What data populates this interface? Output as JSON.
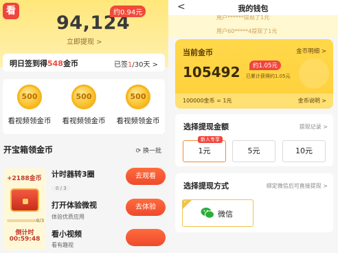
{
  "left": {
    "logo_char": "看",
    "balance": "94,124",
    "balance_badge": "约0.94元",
    "withdraw_link": "立即提现 >",
    "signin": {
      "label_prefix": "明日签到得",
      "label_amount": "548",
      "label_suffix": "金币",
      "status_prefix": "已签",
      "status_done": "1",
      "status_suffix": "/30天 >"
    },
    "coin_tasks": [
      {
        "value": "500",
        "label": "看视频领金币"
      },
      {
        "value": "500",
        "label": "看视频领金币"
      },
      {
        "value": "500",
        "label": "看视频领金币"
      }
    ],
    "chest_section": {
      "title": "开宝箱领金币",
      "refresh": "换一批",
      "chest": {
        "coins": "+2188金币",
        "progress_count": "0/3",
        "progress": 0,
        "timer_label": "倒计时",
        "timer": "00:59:48"
      },
      "tasks": [
        {
          "title": "计时器转3圈",
          "pill": "0 / 3",
          "sub": "",
          "button": "去观看"
        },
        {
          "title": "打开体验微视",
          "pill": "",
          "sub": "体验优质应用",
          "button": "去体验"
        },
        {
          "title": "看小视频",
          "pill": "",
          "sub": "看有趣视",
          "button": ""
        }
      ]
    }
  },
  "right": {
    "nav": {
      "back": "<",
      "title": "我的钱包"
    },
    "ticker": {
      "line1": "用户******提现了1元",
      "line2": "用户60*****4提现了1元"
    },
    "coin_card": {
      "title": "当前金币",
      "detail_link": "金币明细 >",
      "badge": "约1.05元",
      "value": "105492",
      "earned": "已累计获得约1.05元",
      "rate": "100000金币 = 1元",
      "help_link": "金币说明 >"
    },
    "amount_section": {
      "title": "选择提现金额",
      "link": "提现记录 >",
      "new_tag": "新人专享",
      "options": [
        "1元",
        "5元",
        "10元"
      ],
      "selected_index": 0
    },
    "method_section": {
      "title": "选择提现方式",
      "link": "绑定微信后可直接提现 >",
      "option": "微信",
      "check": "✓"
    }
  },
  "colors": {
    "accent_red": "#f04b3a",
    "accent_orange": "#ee4a2c",
    "gold": "#ffd84a",
    "wechat_green": "#2aae3a"
  }
}
